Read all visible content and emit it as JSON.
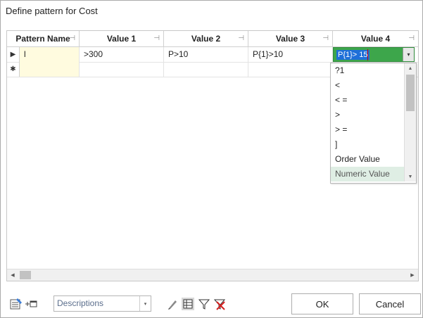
{
  "window": {
    "title": "Define pattern for Cost"
  },
  "grid": {
    "columns": [
      {
        "label": "Pattern Name",
        "pin": "⊣"
      },
      {
        "label": "Value 1",
        "pin": "⊣"
      },
      {
        "label": "Value 2",
        "pin": "⊣"
      },
      {
        "label": "Value 3",
        "pin": "⊣"
      },
      {
        "label": "Value 4",
        "pin": "⊣"
      }
    ],
    "rows": [
      {
        "indicator": "▶",
        "cells": [
          "l",
          ">300",
          "P>10",
          "P{1}>10",
          "P{1}> 15"
        ]
      },
      {
        "indicator": "✱",
        "cells": [
          "",
          "",
          "",
          "",
          ""
        ]
      }
    ],
    "editor": {
      "text": "P{1}> 15",
      "dropdown_icon": "▾"
    },
    "dropdown": {
      "items": [
        "?1",
        "<",
        "< =",
        ">",
        "> =",
        "]",
        "Order Value",
        "Numeric Value"
      ],
      "highlighted_index": 7,
      "scroll_up": "▲",
      "scroll_down": "▼"
    },
    "hscroll": {
      "left": "◀",
      "right": "▶"
    }
  },
  "footer": {
    "view_select": {
      "value": "Descriptions",
      "arrow": "▾"
    },
    "ok_label": "OK",
    "cancel_label": "Cancel"
  },
  "colors": {
    "editor_bg": "#3da64b",
    "selection": "#1e6fd9",
    "highlight_row": "#dfeee4",
    "pattern_name_bg": "#fffbdf"
  }
}
